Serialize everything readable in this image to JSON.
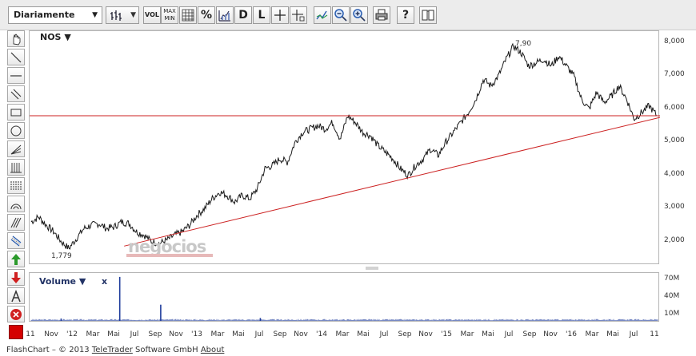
{
  "toolbar": {
    "interval": "Diariamente",
    "vol_label": "VOL",
    "maxmin_label_top": "MAX",
    "maxmin_label_bottom": "MIN",
    "percent_label": "%",
    "d_label": "D",
    "l_label": "L",
    "help_label": "?"
  },
  "chart": {
    "symbol": "NOS",
    "symbol_arrow": "▼",
    "volume_label": "Volume ▼",
    "volume_close": "x",
    "annotations": {
      "high": "7,90",
      "low": "1,779"
    },
    "watermark": "negocios",
    "hline_color": "#cc2222",
    "trendline_color": "#cc2222",
    "price_color": "#1a1a1a",
    "volume_color": "#1f3c9c"
  },
  "chart_data": {
    "type": "line",
    "title": "NOS",
    "y_ticks": [
      "8,000",
      "7,000",
      "6,000",
      "5,000",
      "4,000",
      "3,000",
      "2,000"
    ],
    "ylim": [
      1.3,
      8.35
    ],
    "x_ticks": [
      "11",
      "Nov",
      "'12",
      "Mar",
      "Mai",
      "Jul",
      "Sep",
      "Nov",
      "'13",
      "Mar",
      "Mai",
      "Jul",
      "Sep",
      "Nov",
      "'14",
      "Mar",
      "Mai",
      "Jul",
      "Sep",
      "Nov",
      "'15",
      "Mar",
      "Mai",
      "Jul",
      "Sep",
      "Nov",
      "'16",
      "Mar",
      "Mai",
      "Jul",
      "11"
    ],
    "series": [
      {
        "values": [
          2.6,
          2.75,
          2.5,
          2.3,
          2.0,
          1.8,
          2.1,
          2.4,
          2.5,
          2.55,
          2.4,
          2.45,
          2.6,
          2.55,
          2.3,
          2.2,
          2.0,
          1.95,
          2.05,
          2.2,
          2.3,
          2.5,
          2.8,
          3.0,
          3.3,
          3.5,
          3.4,
          3.2,
          3.4,
          3.3,
          3.6,
          4.2,
          4.3,
          4.5,
          4.4,
          5.0,
          5.3,
          5.4,
          5.5,
          5.4,
          5.6,
          5.1,
          5.8,
          5.6,
          5.3,
          5.2,
          4.9,
          4.7,
          4.5,
          4.2,
          4.0,
          4.3,
          4.5,
          4.8,
          4.6,
          5.0,
          5.3,
          5.6,
          5.9,
          6.3,
          6.9,
          6.7,
          7.0,
          7.5,
          7.9,
          7.7,
          7.3,
          7.4,
          7.5,
          7.3,
          7.6,
          7.3,
          7.0,
          6.3,
          6.0,
          6.5,
          6.2,
          6.4,
          6.7,
          6.3,
          5.7,
          5.9,
          6.1,
          5.8
        ]
      }
    ],
    "volume_ticks": [
      "70M",
      "40M",
      "10M"
    ],
    "volume_ylim": [
      0,
      80
    ],
    "volume_spikes": [
      {
        "x": 0.143,
        "value": 76
      },
      {
        "x": 0.208,
        "value": 28
      },
      {
        "x": 0.366,
        "value": 5
      },
      {
        "x": 0.05,
        "value": 4
      }
    ],
    "horizontal_line": 5.8,
    "trendline": {
      "from": [
        0.15,
        1.87
      ],
      "to": [
        1.0,
        5.75
      ]
    }
  },
  "footer": {
    "prefix": "FlashChart – © 2013 ",
    "company": "TeleTrader",
    "middle": " Software GmbH ",
    "about": "About"
  }
}
